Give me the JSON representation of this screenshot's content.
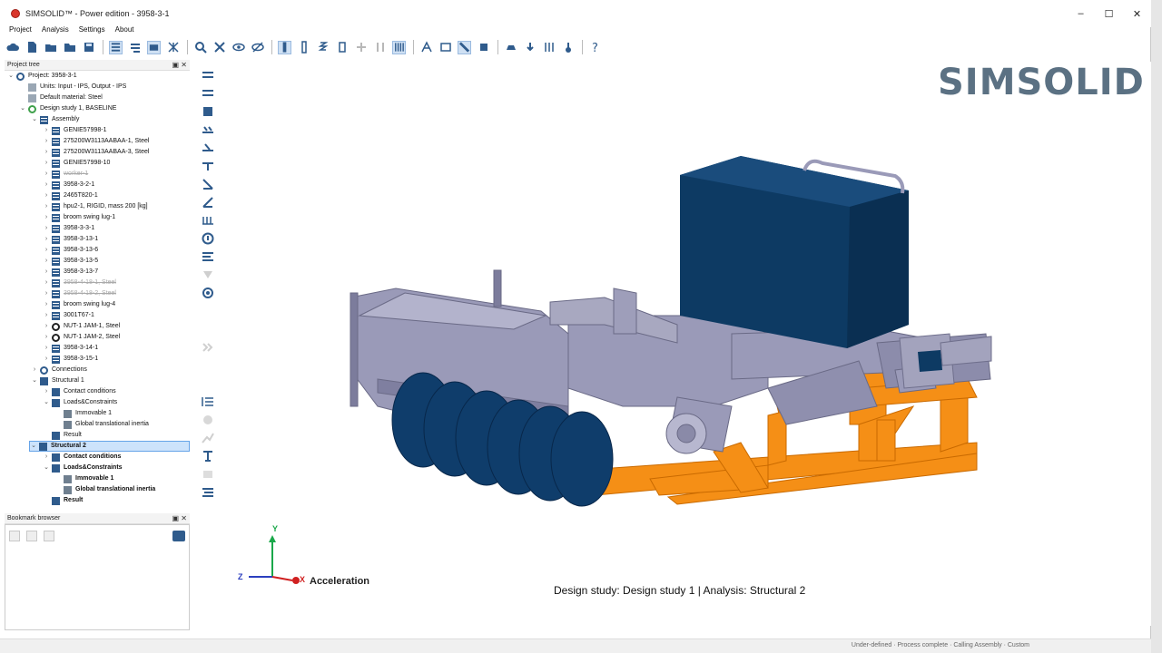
{
  "window": {
    "title": "SIMSOLID™ - Power edition  -  3958-3-1",
    "controls": [
      "–",
      "☐",
      "✕"
    ]
  },
  "menu": [
    "Project",
    "Analysis",
    "Settings",
    "About"
  ],
  "project_tree": {
    "header": "Project tree",
    "rows": [
      {
        "label": "Project: 3958-3-1",
        "level": 0,
        "twisty": "v",
        "icon": "project-icon"
      },
      {
        "label": "Units: Input - IPS, Output - IPS",
        "level": 1,
        "twisty": "",
        "icon": "units-icon"
      },
      {
        "label": "Default material: Steel",
        "level": 1,
        "twisty": "",
        "icon": "material-icon"
      },
      {
        "label": "Design study 1, BASELINE",
        "level": 1,
        "twisty": "v",
        "icon": "design-study-icon"
      },
      {
        "label": "Assembly",
        "level": 2,
        "twisty": "v",
        "icon": "assembly-icon"
      },
      {
        "label": "GENIE57998-1",
        "level": 3,
        "twisty": ">",
        "icon": "part-icon"
      },
      {
        "label": "275200W3113AABAA-1, Steel",
        "level": 3,
        "twisty": ">",
        "icon": "part-icon"
      },
      {
        "label": "275200W3113AABAA-3, Steel",
        "level": 3,
        "twisty": ">",
        "icon": "part-icon"
      },
      {
        "label": "GENIE57998-10",
        "level": 3,
        "twisty": ">",
        "icon": "part-icon"
      },
      {
        "label": "worker-1",
        "level": 3,
        "twisty": ">",
        "icon": "part-icon",
        "strike": true
      },
      {
        "label": "3958-3-2-1",
        "level": 3,
        "twisty": ">",
        "icon": "part-icon"
      },
      {
        "label": "2465T820-1",
        "level": 3,
        "twisty": ">",
        "icon": "part-icon"
      },
      {
        "label": "hpu2-1, RIGID, mass 200 [kg]",
        "level": 3,
        "twisty": ">",
        "icon": "part-icon"
      },
      {
        "label": "broom swing lug-1",
        "level": 3,
        "twisty": ">",
        "icon": "part-icon"
      },
      {
        "label": "3958-3-3-1",
        "level": 3,
        "twisty": ">",
        "icon": "part-icon"
      },
      {
        "label": "3958-3-13-1",
        "level": 3,
        "twisty": ">",
        "icon": "part-icon"
      },
      {
        "label": "3958-3-13-6",
        "level": 3,
        "twisty": ">",
        "icon": "part-icon"
      },
      {
        "label": "3958-3-13-5",
        "level": 3,
        "twisty": ">",
        "icon": "part-icon"
      },
      {
        "label": "3958-3-13-7",
        "level": 3,
        "twisty": ">",
        "icon": "part-icon"
      },
      {
        "label": "3958-4-18-1, Steel",
        "level": 3,
        "twisty": ">",
        "icon": "part-icon",
        "strike": true
      },
      {
        "label": "3958-4-18-2, Steel",
        "level": 3,
        "twisty": ">",
        "icon": "part-icon",
        "strike": true
      },
      {
        "label": "broom swing lug-4",
        "level": 3,
        "twisty": ">",
        "icon": "part-icon"
      },
      {
        "label": "3001T67-1",
        "level": 3,
        "twisty": ">",
        "icon": "part-icon"
      },
      {
        "label": "NUT-1 JAM-1, Steel",
        "level": 3,
        "twisty": ">",
        "icon": "nut-icon"
      },
      {
        "label": "NUT-1 JAM-2, Steel",
        "level": 3,
        "twisty": ">",
        "icon": "nut-icon"
      },
      {
        "label": "3958-3-14-1",
        "level": 3,
        "twisty": ">",
        "icon": "part-icon"
      },
      {
        "label": "3958-3-15-1",
        "level": 3,
        "twisty": ">",
        "icon": "part-icon"
      },
      {
        "label": "Connections",
        "level": 2,
        "twisty": ">",
        "icon": "connections-icon"
      },
      {
        "label": "Structural  1",
        "level": 2,
        "twisty": "v",
        "icon": "structural-icon"
      },
      {
        "label": "Contact conditions",
        "level": 3,
        "twisty": ">",
        "icon": "contact-icon"
      },
      {
        "label": "Loads&Constraints",
        "level": 3,
        "twisty": "v",
        "icon": "loads-icon"
      },
      {
        "label": "Immovable 1",
        "level": 4,
        "twisty": "",
        "icon": "immovable-icon"
      },
      {
        "label": "Global translational inertia",
        "level": 4,
        "twisty": "",
        "icon": "inertia-icon"
      },
      {
        "label": "Result",
        "level": 3,
        "twisty": "",
        "icon": "result-icon"
      },
      {
        "label": "Structural  2",
        "level": 2,
        "twisty": "v",
        "icon": "structural-icon",
        "selected": true,
        "bold": true
      },
      {
        "label": "Contact conditions",
        "level": 3,
        "twisty": ">",
        "icon": "contact-icon",
        "bold": true
      },
      {
        "label": "Loads&Constraints",
        "level": 3,
        "twisty": "v",
        "icon": "loads-icon",
        "bold": true
      },
      {
        "label": "Immovable 1",
        "level": 4,
        "twisty": "",
        "icon": "immovable-icon",
        "bold": true
      },
      {
        "label": "Global translational inertia",
        "level": 4,
        "twisty": "",
        "icon": "inertia-icon",
        "bold": true
      },
      {
        "label": "Result",
        "level": 3,
        "twisty": "",
        "icon": "result-icon",
        "bold": true
      }
    ]
  },
  "bookmark_browser": {
    "header": "Bookmark browser"
  },
  "viewport": {
    "logo": "SIMSOLID",
    "caption": "Design study: Design study 1 | Analysis: Structural  2",
    "triad": {
      "y": "Y",
      "z": "Z",
      "x": "X",
      "label": "Acceleration"
    }
  },
  "status_bar": {
    "text": "Under-defined · Process complete · Calling Assembly · Custom"
  },
  "colors": {
    "frame": "#f58f16",
    "body": "#9a9ab8",
    "tank": "#0d3a63",
    "rollers": "#0f3d6b",
    "logo": "#5b7183"
  }
}
